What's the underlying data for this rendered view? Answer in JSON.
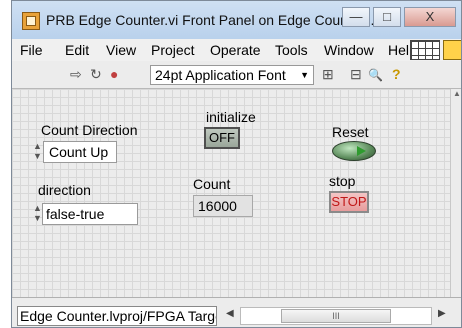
{
  "window": {
    "title": "PRB Edge Counter.vi Front Panel on Edge Counter.l...",
    "controls": [
      "—",
      "□",
      "X"
    ]
  },
  "menu": [
    "File",
    "Edit",
    "View",
    "Project",
    "Operate",
    "Tools",
    "Window",
    "Hel"
  ],
  "toolbar": {
    "run_icon": "⇨",
    "continuous_icon": "↻",
    "abort_icon": "●",
    "font": "24pt Application Font",
    "align_icon": "⊞",
    "distribute_icon": "⊟",
    "search_icon": "🔍",
    "help_icon": "?"
  },
  "panel": {
    "initialize_label": "initialize",
    "initialize_value": "OFF",
    "count_direction_label": "Count Direction",
    "count_direction_value": "Count Up",
    "reset_label": "Reset",
    "direction_label": "direction",
    "direction_value": "false-true",
    "count_label": "Count",
    "count_value": "16000",
    "stop_label": "stop",
    "stop_button": "STOP"
  },
  "status": {
    "target": "Edge Counter.lvproj/FPGA Target",
    "scroll_mid": "III"
  }
}
